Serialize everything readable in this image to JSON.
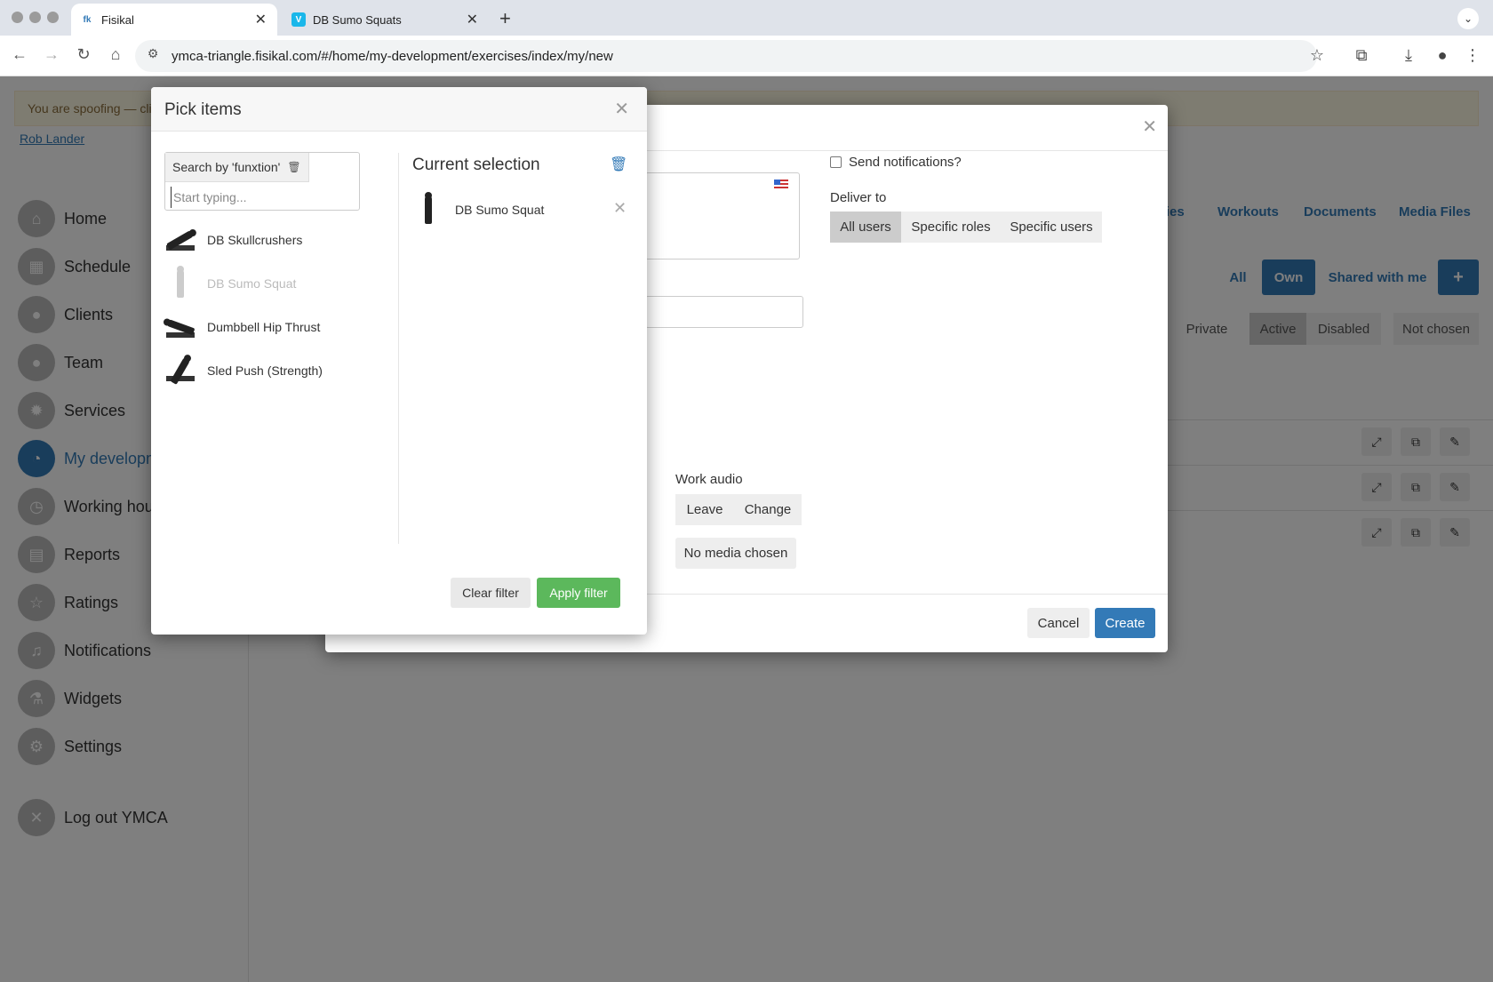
{
  "browser": {
    "tabs": [
      {
        "favicon": "fk",
        "title": "Fisikal"
      },
      {
        "favicon": "V",
        "title": "DB Sumo Squats"
      }
    ],
    "url": "ymca-triangle.fisikal.com/#/home/my-development/exercises/index/my/new"
  },
  "app": {
    "spoof_text": "You are spoofing — cli",
    "user_link": "Rob Lander",
    "sidebar": [
      {
        "label": "Home",
        "icon": "home-icon"
      },
      {
        "label": "Schedule",
        "icon": "calendar-icon"
      },
      {
        "label": "Clients",
        "icon": "users-icon"
      },
      {
        "label": "Team",
        "icon": "team-icon"
      },
      {
        "label": "Services",
        "icon": "gear-icon"
      },
      {
        "label": "My developm",
        "icon": "dashboard-icon",
        "active": true
      },
      {
        "label": "Working hour",
        "icon": "clock-icon"
      },
      {
        "label": "Reports",
        "icon": "report-icon"
      },
      {
        "label": "Ratings",
        "icon": "star-icon"
      },
      {
        "label": "Notifications",
        "icon": "bell-icon"
      },
      {
        "label": "Widgets",
        "icon": "flask-icon"
      },
      {
        "label": "Settings",
        "icon": "settings-icon"
      },
      {
        "label": "Log out YMCA",
        "icon": "logout-icon"
      }
    ],
    "topnav": [
      "ries",
      "Workouts",
      "Documents",
      "Media Files"
    ],
    "ownership_filters": [
      "All",
      "Own",
      "Shared with me"
    ],
    "add_label": "+",
    "status_filters": [
      "Private",
      "Active",
      "Disabled",
      "Not chosen"
    ]
  },
  "create_modal": {
    "send_notifications": "Send notifications?",
    "deliver_to_label": "Deliver to",
    "deliver_options": [
      "All users",
      "Specific roles",
      "Specific users"
    ],
    "work_audio_label": "Work audio",
    "audio_buttons": [
      "Leave",
      "Change"
    ],
    "no_media": "No media chosen",
    "cancel": "Cancel",
    "create": "Create"
  },
  "pick_modal": {
    "title": "Pick items",
    "search_tag": "Search by 'funxtion'",
    "search_placeholder": "Start typing...",
    "items": [
      {
        "name": "DB Skullcrushers",
        "dim": false
      },
      {
        "name": "DB Sumo Squat",
        "dim": true
      },
      {
        "name": "Dumbbell Hip Thrust",
        "dim": false
      },
      {
        "name": "Sled Push (Strength)",
        "dim": false
      }
    ],
    "current_selection_title": "Current selection",
    "selected": [
      {
        "name": "DB Sumo Squat"
      }
    ],
    "clear_filter": "Clear filter",
    "apply_filter": "Apply filter"
  }
}
